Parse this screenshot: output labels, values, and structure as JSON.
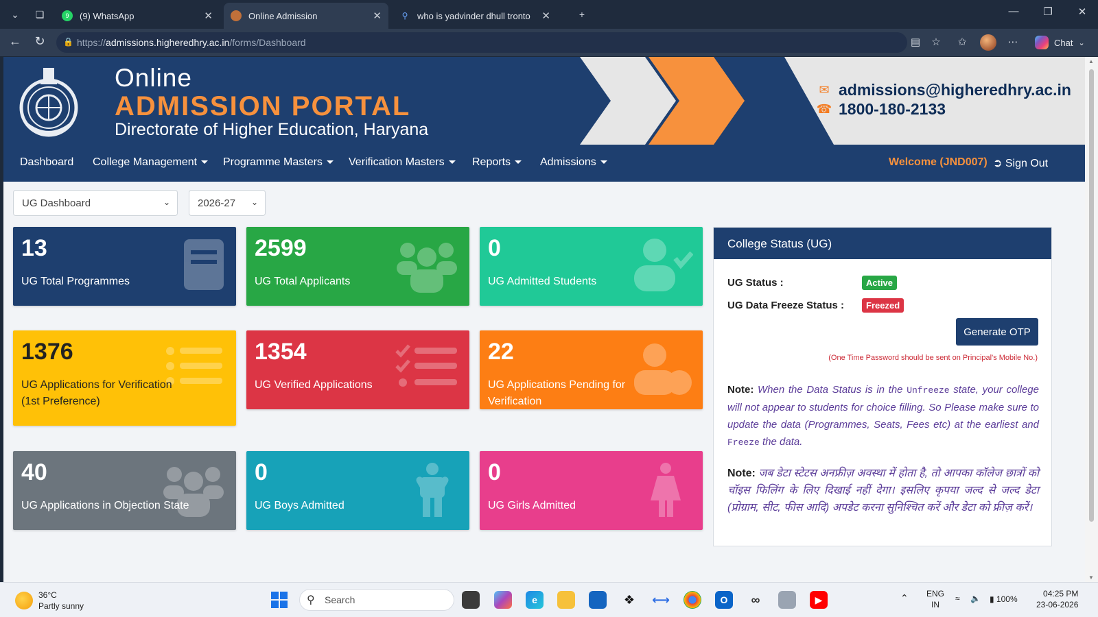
{
  "browser": {
    "tabs": [
      {
        "title": "(9) WhatsApp",
        "badge": "9",
        "active": false
      },
      {
        "title": "Online Admission",
        "active": true
      },
      {
        "title": "who is yadvinder dhull tronto",
        "active": false
      }
    ],
    "url_scheme": "https://",
    "url_host": "admissions.higheredhry.ac.in",
    "url_path": "/forms/Dashboard",
    "chat_label": "Chat"
  },
  "banner": {
    "line1": "Online",
    "line2": "ADMISSION PORTAL",
    "line3": "Directorate of Higher Education, Haryana",
    "email": "admissions@higheredhry.ac.in",
    "phone": "1800-180-2133",
    "colors": {
      "navy": "#1e3f6f",
      "orange": "#f7913d"
    }
  },
  "nav": {
    "items": [
      {
        "label": "Dashboard",
        "dropdown": false
      },
      {
        "label": "College Management",
        "dropdown": true
      },
      {
        "label": "Programme Masters",
        "dropdown": true
      },
      {
        "label": "Verification Masters",
        "dropdown": true
      },
      {
        "label": "Reports",
        "dropdown": true
      },
      {
        "label": "Admissions",
        "dropdown": true
      }
    ],
    "welcome": "Welcome (JND007)",
    "signout": "Sign Out"
  },
  "filters": {
    "dashboard": "UG Dashboard",
    "session": "2026-27"
  },
  "cards": [
    {
      "value": "13",
      "label": "UG Total Programmes",
      "color": "#1e3f6f",
      "icon": "book-icon"
    },
    {
      "value": "2599",
      "label": "UG Total Applicants",
      "color": "#28a745",
      "icon": "users-icon"
    },
    {
      "value": "0",
      "label": "UG Admitted Students",
      "color": "#20c997",
      "icon": "user-check-icon"
    },
    {
      "value": "1376",
      "label": "UG Applications for Verification (1st Preference)",
      "color": "#ffc107",
      "text_color": "#222222",
      "icon": "list-icon"
    },
    {
      "value": "1354",
      "label": "UG Verified Applications",
      "color": "#dc3545",
      "icon": "checklist-icon"
    },
    {
      "value": "22",
      "label": "UG Applications Pending for Verification",
      "color": "#fd7e14",
      "icon": "user-clock-icon"
    },
    {
      "value": "40",
      "label": "UG Applications in Objection State",
      "color": "#6c757d",
      "icon": "users-icon"
    },
    {
      "value": "0",
      "label": "UG Boys Admitted",
      "color": "#17a2b8",
      "icon": "male-icon"
    },
    {
      "value": "0",
      "label": "UG Girls Admitted",
      "color": "#e83e8c",
      "icon": "female-icon"
    }
  ],
  "status": {
    "title": "College Status (UG)",
    "ug_status_label": "UG Status :",
    "ug_status_value": "Active",
    "freeze_label": "UG Data Freeze Status :",
    "freeze_value": "Freezed",
    "otp_button": "Generate OTP",
    "otp_note": "(One Time Password should be sent on Principal's Mobile No.)",
    "note_label": "Note:",
    "note_en_1": "When the Data Status is in the",
    "note_en_code1": "Unfreeze",
    "note_en_2": "state, your college will not appear to students for choice filling. So Please make sure to update the data (Programmes, Seats, Fees etc) at the earliest and",
    "note_en_code2": "Freeze",
    "note_en_3": "the data.",
    "note_hi": "जब डेटा स्टेटस अनफ्रीज़ अवस्था में होता है, तो आपका कॉलेज छात्रों को चॉइस फिलिंग के लिए दिखाई नहीं देगा। इसलिए कृपया जल्द से जल्द डेटा (प्रोग्राम, सीट, फीस आदि) अपडेट करना सुनिश्चित करें और डेटा को फ्रीज़ करें।"
  },
  "taskbar": {
    "temp": "36°C",
    "weather": "Partly sunny",
    "search": "Search",
    "lang1": "ENG",
    "lang2": "IN",
    "battery": "100%",
    "time": "04:25 PM",
    "date": "23-06-2026"
  }
}
